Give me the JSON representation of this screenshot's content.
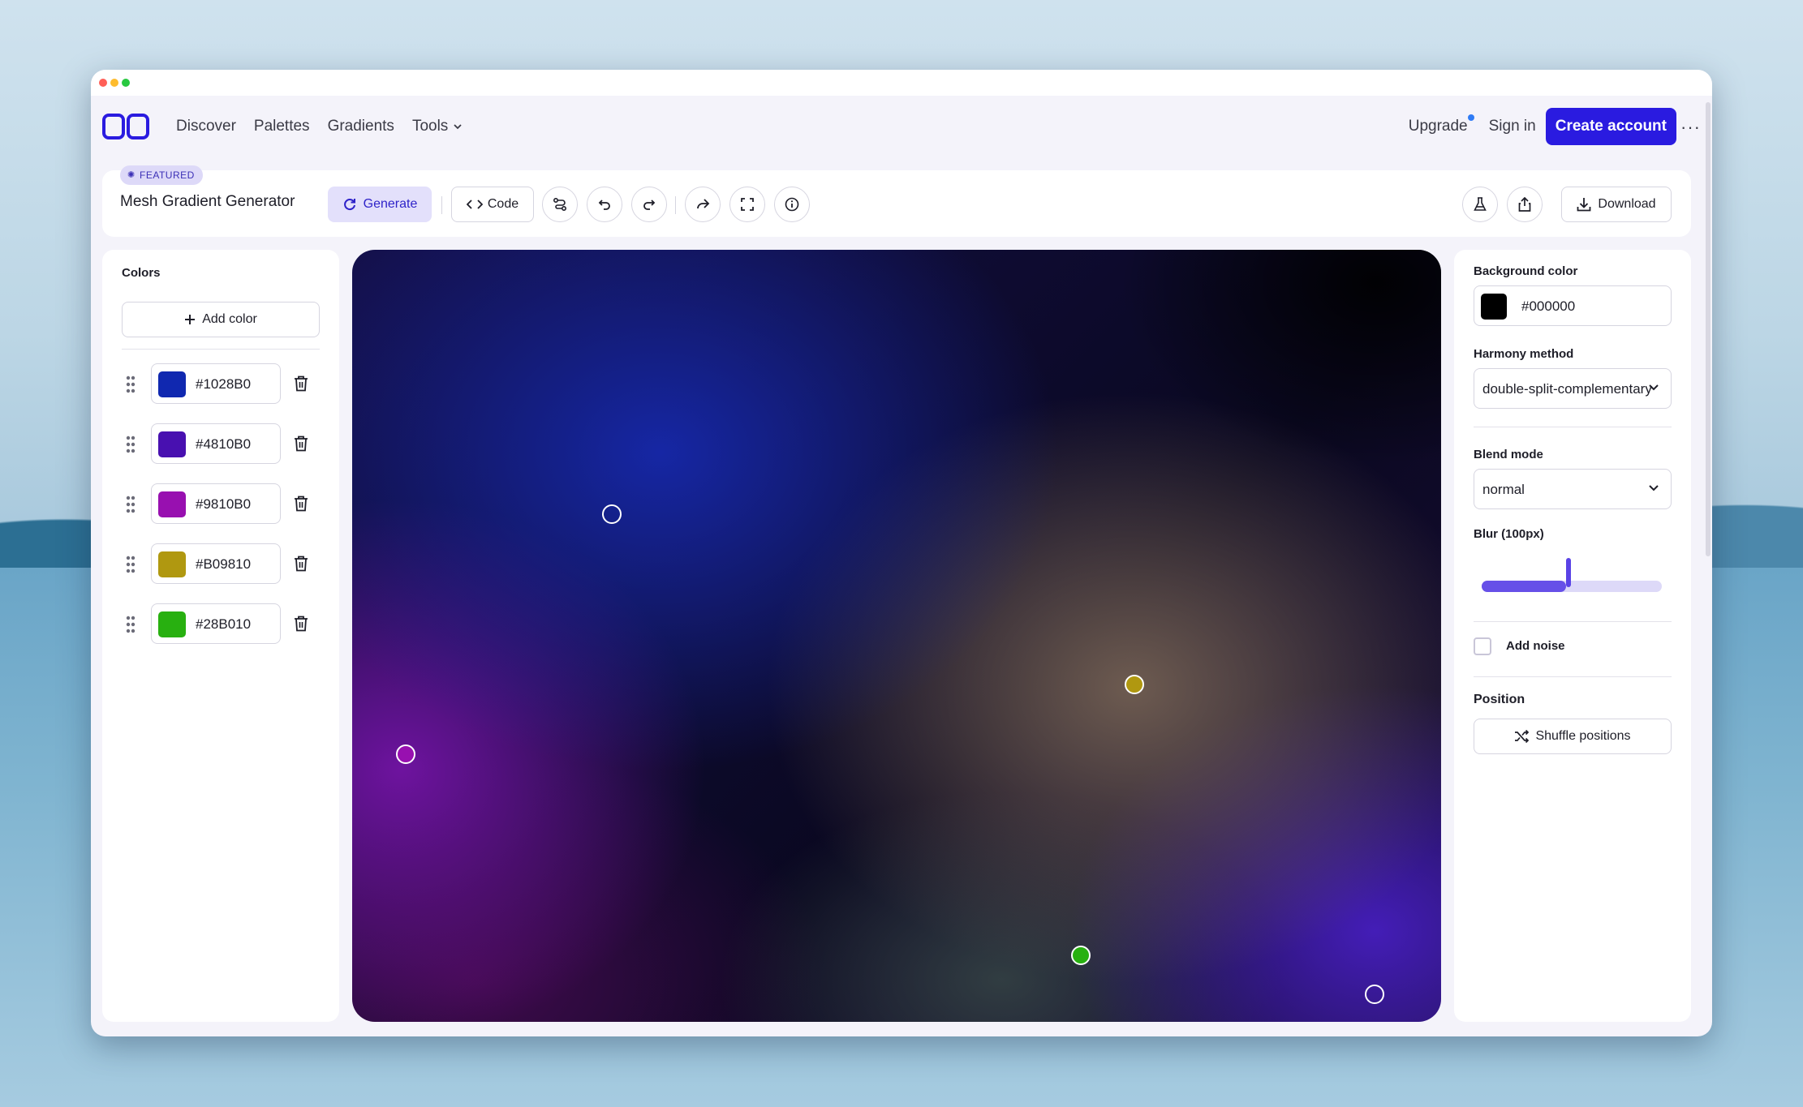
{
  "nav": {
    "links": [
      "Discover",
      "Palettes",
      "Gradients",
      "Tools"
    ],
    "upgrade": "Upgrade",
    "sign_in": "Sign in",
    "create_account": "Create account"
  },
  "toolbar": {
    "featured": "FEATURED",
    "title": "Mesh Gradient Generator",
    "generate": "Generate",
    "code": "Code",
    "download": "Download"
  },
  "colors_panel": {
    "label": "Colors",
    "add_color": "Add color",
    "colors": [
      {
        "hex": "#1028B0",
        "swatch": "#1028b0"
      },
      {
        "hex": "#4810B0",
        "swatch": "#4810b0"
      },
      {
        "hex": "#9810B0",
        "swatch": "#9810b0"
      },
      {
        "hex": "#B09810",
        "swatch": "#b09810"
      },
      {
        "hex": "#28B010",
        "swatch": "#28b010"
      }
    ]
  },
  "settings": {
    "background_label": "Background color",
    "background_value": "#000000",
    "background_swatch": "#000000",
    "harmony_label": "Harmony method",
    "harmony_value": "double-split-complementary",
    "blend_label": "Blend mode",
    "blend_value": "normal",
    "blur_label": "Blur (100px)",
    "blur_fraction": 0.47,
    "noise_label": "Add noise",
    "noise_checked": false,
    "position_label": "Position",
    "shuffle_label": "Shuffle positions"
  },
  "accent_color": "#2a1be0"
}
